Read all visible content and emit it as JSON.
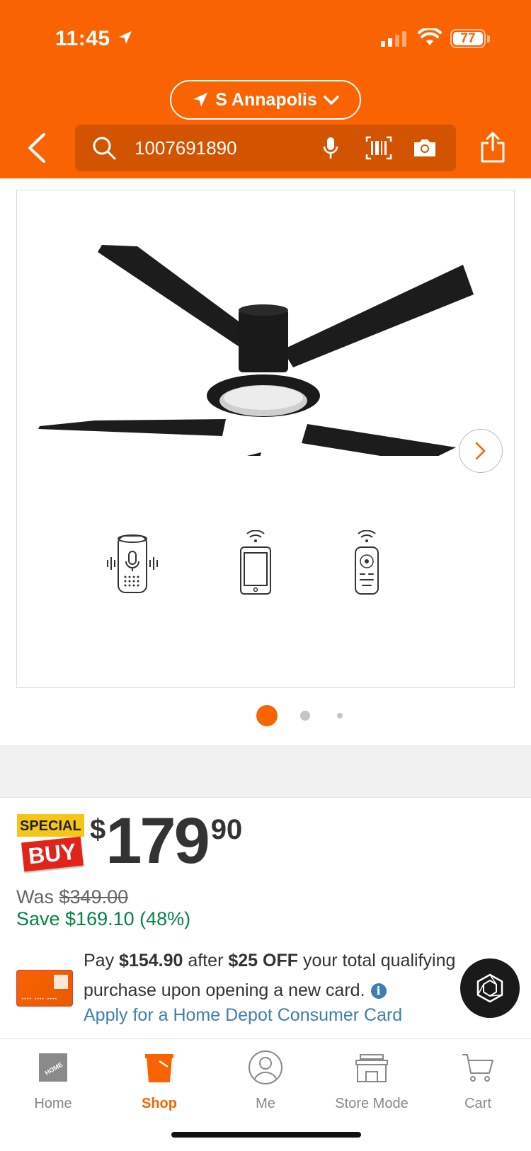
{
  "status_bar": {
    "time": "11:45",
    "battery": "77"
  },
  "header": {
    "store_name": "S Annapolis",
    "search_value": "1007691890"
  },
  "product": {
    "badge_top": "SPECIAL",
    "badge_bottom": "BUY",
    "price_symbol": "$",
    "price_dollars": "179",
    "price_cents": "90",
    "was_label": "Was",
    "was_price": "$349.00",
    "save_text": "Save $169.10 (48%)",
    "image_pages": 3,
    "image_active_index": 0
  },
  "promo": {
    "pay_prefix": "Pay",
    "pay_amount": "$154.90",
    "after_text": "after",
    "discount": "$25 OFF",
    "rest_line1": "your total qualifying",
    "line2": "purchase upon opening a new card.",
    "apply_link": "Apply for a Home Depot Consumer Card"
  },
  "tabs": [
    {
      "label": "Home",
      "icon": "home-depot-logo-icon",
      "active": false
    },
    {
      "label": "Shop",
      "icon": "bucket-icon",
      "active": true
    },
    {
      "label": "Me",
      "icon": "user-icon",
      "active": false
    },
    {
      "label": "Store Mode",
      "icon": "store-icon",
      "active": false
    },
    {
      "label": "Cart",
      "icon": "cart-icon",
      "active": false
    }
  ],
  "colors": {
    "brand": "#f96302",
    "link": "#3e7eb0",
    "savings": "#00853f",
    "badge_red": "#e2231a",
    "badge_yellow": "#f5c518"
  }
}
